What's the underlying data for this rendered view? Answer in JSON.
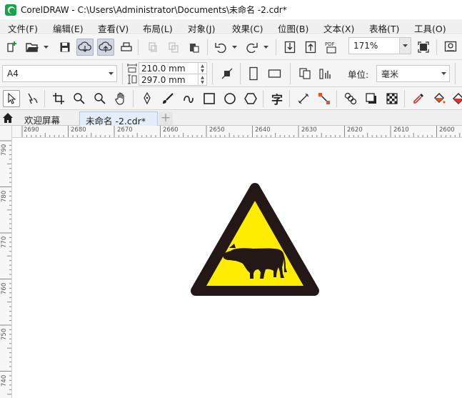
{
  "window": {
    "title": "CorelDRAW - C:\\Users\\Administrator\\Documents\\未命名 -2.cdr*"
  },
  "menu": [
    "文件(F)",
    "编辑(E)",
    "查看(V)",
    "布局(L)",
    "对象(J)",
    "效果(C)",
    "位图(B)",
    "文本(X)",
    "表格(T)",
    "工具(O)"
  ],
  "toolbar": {
    "zoom": "171%",
    "pdf_label": "PDF"
  },
  "property_bar": {
    "page_preset": "A4",
    "width": "210.0 mm",
    "height": "297.0 mm",
    "units_label": "单位:",
    "units_value": "毫米"
  },
  "toolbox": {
    "text_tool_glyph": "字"
  },
  "tabs": {
    "welcome": "欢迎屏幕",
    "document": "未命名 -2.cdr*",
    "add": "+"
  },
  "ruler": {
    "horizontal": [
      "2690",
      "2680",
      "2670",
      "2660",
      "2650",
      "2640",
      "2630",
      "2620",
      "2610",
      "2600"
    ],
    "vertical": [
      "790",
      "780",
      "770",
      "760",
      "750",
      "740"
    ]
  },
  "artwork": {
    "description_icon": "cow-warning-sign",
    "fill": "#ffed00",
    "stroke": "#231815"
  },
  "colors": {
    "accent": "#17a34a",
    "active_tab": "#e4eefa"
  }
}
